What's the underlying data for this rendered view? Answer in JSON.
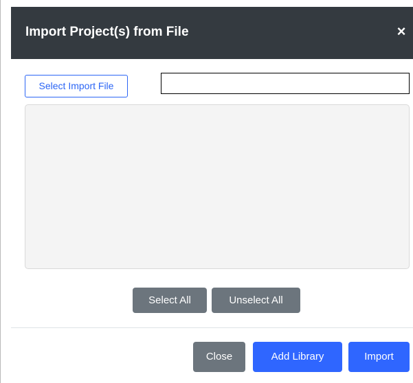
{
  "dialog": {
    "title": "Import Project(s) from File",
    "close_icon": "×"
  },
  "file_picker": {
    "select_button_label": "Select Import File",
    "file_name_value": ""
  },
  "selection": {
    "select_all_label": "Select All",
    "unselect_all_label": "Unselect All"
  },
  "footer": {
    "close_label": "Close",
    "add_library_label": "Add Library",
    "import_label": "Import"
  },
  "colors": {
    "header_bg": "#343a40",
    "primary": "#2f66ff",
    "secondary": "#6c757d",
    "outline_primary": "#2b65f5"
  }
}
